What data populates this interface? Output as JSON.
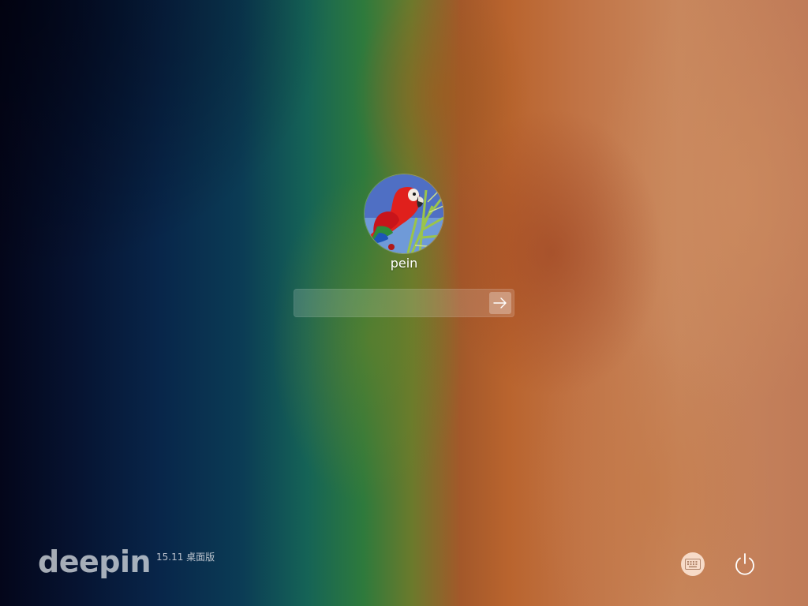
{
  "login": {
    "username": "pein",
    "password_value": "",
    "password_placeholder": "",
    "submit_icon": "arrow-right-icon"
  },
  "avatar": {
    "icon": "parrot-avatar"
  },
  "branding": {
    "logo": "deepin",
    "version": "15.11 桌面版"
  },
  "controls": {
    "keyboard_icon": "keyboard-icon",
    "power_icon": "power-icon"
  },
  "colors": {
    "text": "#ffffff",
    "keyboard_button_bg": "#f5e6dc"
  }
}
